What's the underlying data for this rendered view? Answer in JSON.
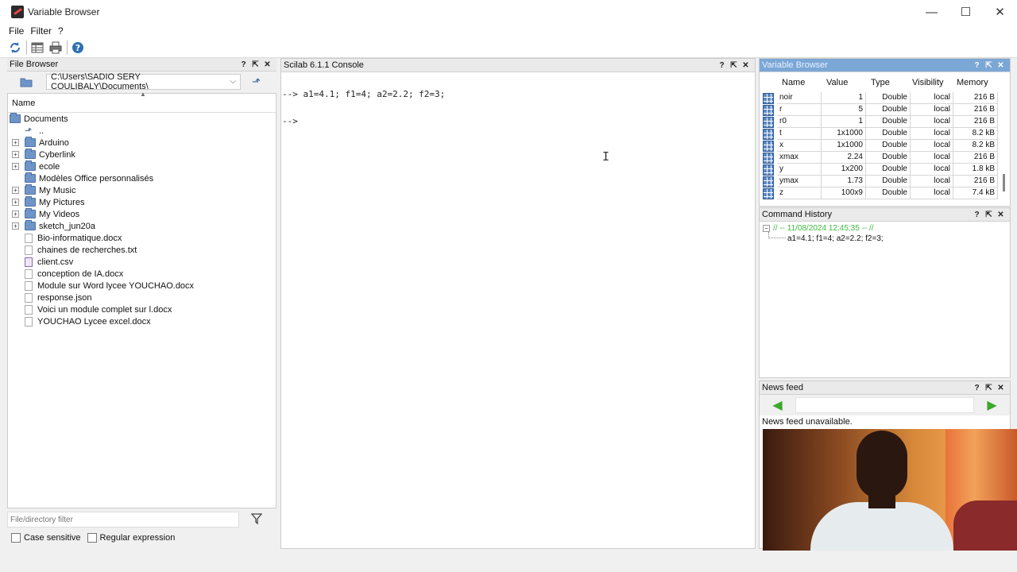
{
  "window": {
    "title": "Variable Browser",
    "minimize": "—",
    "maximize": "☐",
    "close": "✕"
  },
  "menu": [
    "File",
    "Filter",
    "?"
  ],
  "toolbar": {
    "buttons": [
      "refresh-icon",
      "table-icon",
      "print-icon",
      "help-icon"
    ]
  },
  "file_browser": {
    "title": "File Browser",
    "path": "C:\\Users\\SADIO SERY COULIBALY\\Documents\\",
    "column": "Name",
    "root": "Documents",
    "up_entry": "..",
    "folders": [
      "Arduino",
      "Cyberlink",
      "ecole",
      "Modèles Office personnalisés",
      "My Music",
      "My Pictures",
      "My Videos",
      "sketch_jun20a"
    ],
    "files": [
      "Bio-informatique.docx",
      "chaines de recherches.txt",
      "client.csv",
      "conception de IA.docx",
      "Module sur Word lycee YOUCHAO.docx",
      "response.json",
      "Voici un module complet sur l.docx",
      "YOUCHAO Lycee excel.docx"
    ],
    "filter_placeholder": "File/directory filter",
    "case_sensitive": "Case sensitive",
    "regex": "Regular expression"
  },
  "console": {
    "title": "Scilab 6.1.1 Console",
    "line1": "--> a1=4.1; f1=4; a2=2.2; f2=3;",
    "line2": "",
    "line3": "-->"
  },
  "variable_browser": {
    "title": "Variable Browser",
    "columns": [
      "Name",
      "Value",
      "Type",
      "Visibility",
      "Memory"
    ],
    "rows": [
      {
        "name": "noir",
        "value": "1",
        "type": "Double",
        "visibility": "local",
        "memory": "216 B"
      },
      {
        "name": "r",
        "value": "5",
        "type": "Double",
        "visibility": "local",
        "memory": "216 B"
      },
      {
        "name": "r0",
        "value": "1",
        "type": "Double",
        "visibility": "local",
        "memory": "216 B"
      },
      {
        "name": "t",
        "value": "1x1000",
        "type": "Double",
        "visibility": "local",
        "memory": "8.2 kB"
      },
      {
        "name": "x",
        "value": "1x1000",
        "type": "Double",
        "visibility": "local",
        "memory": "8.2 kB"
      },
      {
        "name": "xmax",
        "value": "2.24",
        "type": "Double",
        "visibility": "local",
        "memory": "216 B"
      },
      {
        "name": "y",
        "value": "1x200",
        "type": "Double",
        "visibility": "local",
        "memory": "1.8 kB"
      },
      {
        "name": "ymax",
        "value": "1.73",
        "type": "Double",
        "visibility": "local",
        "memory": "216 B"
      },
      {
        "name": "z",
        "value": "100x9",
        "type": "Double",
        "visibility": "local",
        "memory": "7.4 kB"
      }
    ]
  },
  "command_history": {
    "title": "Command History",
    "session": "// -- 11/08/2024 12:45:35 -- //",
    "command": "a1=4.1; f1=4; a2=2.2; f2=3;"
  },
  "news_feed": {
    "title": "News feed",
    "message": "News feed unavailable."
  },
  "panel_buttons": [
    "?",
    "⇱",
    "✕"
  ]
}
